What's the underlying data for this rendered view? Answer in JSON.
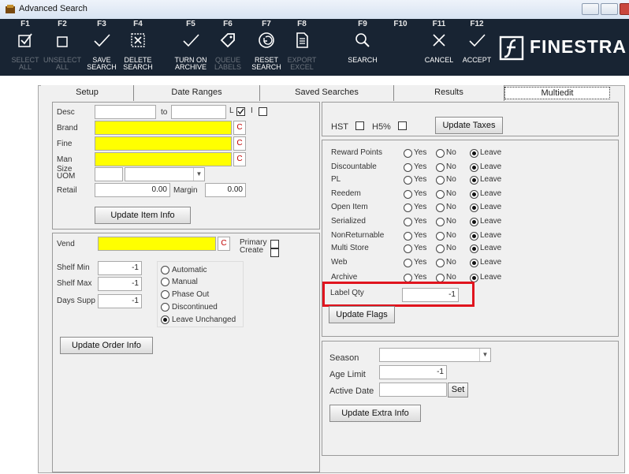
{
  "window": {
    "title": "Advanced Search"
  },
  "toolbar": {
    "buttons": [
      {
        "key": "F1",
        "label1": "SELECT",
        "label2": "ALL",
        "enabled": false
      },
      {
        "key": "F2",
        "label1": "UNSELECT",
        "label2": "ALL",
        "enabled": false
      },
      {
        "key": "F3",
        "label1": "SAVE",
        "label2": "SEARCH",
        "enabled": true
      },
      {
        "key": "F4",
        "label1": "DELETE",
        "label2": "SEARCH",
        "enabled": true
      },
      {
        "key": "F5",
        "label1": "TURN ON",
        "label2": "ARCHIVE",
        "enabled": true
      },
      {
        "key": "F6",
        "label1": "QUEUE",
        "label2": "LABELS",
        "enabled": false
      },
      {
        "key": "F7",
        "label1": "RESET",
        "label2": "SEARCH",
        "enabled": true
      },
      {
        "key": "F8",
        "label1": "EXPORT",
        "label2": "EXCEL",
        "enabled": false
      },
      {
        "key": "F9",
        "label1": "SEARCH",
        "label2": "",
        "enabled": true
      },
      {
        "key": "F10",
        "label1": "",
        "label2": "",
        "enabled": true
      },
      {
        "key": "F11",
        "label1": "CANCEL",
        "label2": "",
        "enabled": true
      },
      {
        "key": "F12",
        "label1": "ACCEPT",
        "label2": "",
        "enabled": true
      }
    ],
    "brand": "FINESTRA"
  },
  "tabs": [
    "Setup",
    "Date Ranges",
    "Saved Searches",
    "Results",
    "Multiedit"
  ],
  "item": {
    "desc_label": "Desc",
    "to_label": "to",
    "l_label": "L",
    "i_label": "I",
    "brand_label": "Brand",
    "fine_label": "Fine",
    "man_label": "Man",
    "size_label": "Size",
    "uom_label": "UOM",
    "retail_label": "Retail",
    "retail_value": "0.00",
    "margin_label": "Margin",
    "margin_value": "0.00",
    "c_label": "C",
    "update_button": "Update Item Info"
  },
  "order": {
    "vend_label": "Vend",
    "primary_label": "Primary",
    "create_label": "Create",
    "shelf_min_label": "Shelf Min",
    "shelf_min_value": "-1",
    "shelf_max_label": "Shelf Max",
    "shelf_max_value": "-1",
    "days_supp_label": "Days Supp",
    "days_supp_value": "-1",
    "options": [
      "Automatic",
      "Manual",
      "Phase Out",
      "Discontinued",
      "Leave Unchanged"
    ],
    "selected_option": 4,
    "update_button": "Update Order Info"
  },
  "taxes": {
    "hst_label": "HST",
    "h5_label": "H5%",
    "update_button": "Update Taxes"
  },
  "flags": {
    "yes_label": "Yes",
    "no_label": "No",
    "leave_label": "Leave",
    "rows": [
      "Reward Points",
      "Discountable",
      "PL",
      "Reedem",
      "Open Item",
      "Serialized",
      "NonReturnable",
      "Multi Store",
      "Web",
      "Archive"
    ],
    "label_qty_label": "Label Qty",
    "label_qty_value": "-1",
    "update_button": "Update Flags",
    "highlight_color": "#e0141e"
  },
  "extra": {
    "season_label": "Season",
    "age_limit_label": "Age Limit",
    "age_limit_value": "-1",
    "active_date_label": "Active Date",
    "set_button": "Set",
    "update_button": "Update Extra Info"
  }
}
